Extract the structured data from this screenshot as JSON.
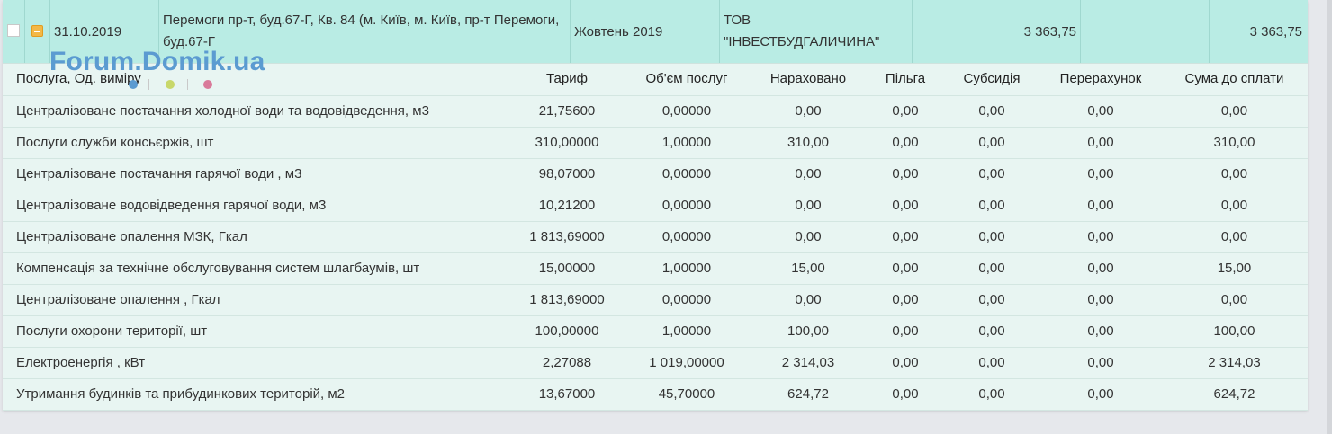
{
  "summary": {
    "date": "31.10.2019",
    "address": "Перемоги пр-т, буд.67-Г, Кв. 84 (м. Київ, м. Київ, пр-т Перемоги, буд.67-Г",
    "period": "Жовтень 2019",
    "company": "ТОВ \"ІНВЕСТБУДГАЛИЧИНА\"",
    "amount1": "3 363,75",
    "amount2": "",
    "amount3": "3 363,75"
  },
  "watermark": "Forum.Domik.ua",
  "legend_dots": [
    "#5b9bd1",
    "#c8d86a",
    "#d97a9a"
  ],
  "headers": {
    "service": "Послуга, Од. виміру",
    "tariff": "Тариф",
    "volume": "Об'єм послуг",
    "accrued": "Нараховано",
    "benefit": "Пільга",
    "subsidy": "Субсидія",
    "recalc": "Перерахунок",
    "total": "Сума до сплати"
  },
  "rows": [
    {
      "service": "Централізоване постачання холодної води та водовідведення, м3",
      "tariff": "21,75600",
      "volume": "0,00000",
      "accrued": "0,00",
      "benefit": "0,00",
      "subsidy": "0,00",
      "recalc": "0,00",
      "total": "0,00"
    },
    {
      "service": "Послуги служби консьєржів, шт",
      "tariff": "310,00000",
      "volume": "1,00000",
      "accrued": "310,00",
      "benefit": "0,00",
      "subsidy": "0,00",
      "recalc": "0,00",
      "total": "310,00"
    },
    {
      "service": "Централізоване постачання гарячої води , м3",
      "tariff": "98,07000",
      "volume": "0,00000",
      "accrued": "0,00",
      "benefit": "0,00",
      "subsidy": "0,00",
      "recalc": "0,00",
      "total": "0,00"
    },
    {
      "service": "Централізоване водовідведення гарячої води, м3",
      "tariff": "10,21200",
      "volume": "0,00000",
      "accrued": "0,00",
      "benefit": "0,00",
      "subsidy": "0,00",
      "recalc": "0,00",
      "total": "0,00"
    },
    {
      "service": "Централізоване опалення МЗК, Гкал",
      "tariff": "1 813,69000",
      "volume": "0,00000",
      "accrued": "0,00",
      "benefit": "0,00",
      "subsidy": "0,00",
      "recalc": "0,00",
      "total": "0,00"
    },
    {
      "service": "Компенсація за технічне обслуговування систем шлагбаумів, шт",
      "tariff": "15,00000",
      "volume": "1,00000",
      "accrued": "15,00",
      "benefit": "0,00",
      "subsidy": "0,00",
      "recalc": "0,00",
      "total": "15,00"
    },
    {
      "service": "Централізоване опалення , Гкал",
      "tariff": "1 813,69000",
      "volume": "0,00000",
      "accrued": "0,00",
      "benefit": "0,00",
      "subsidy": "0,00",
      "recalc": "0,00",
      "total": "0,00"
    },
    {
      "service": "Послуги охорони території, шт",
      "tariff": "100,00000",
      "volume": "1,00000",
      "accrued": "100,00",
      "benefit": "0,00",
      "subsidy": "0,00",
      "recalc": "0,00",
      "total": "100,00"
    },
    {
      "service": "Електроенергія , кВт",
      "tariff": "2,27088",
      "volume": "1 019,00000",
      "accrued": "2 314,03",
      "benefit": "0,00",
      "subsidy": "0,00",
      "recalc": "0,00",
      "total": "2 314,03"
    },
    {
      "service": "Утримання будинків та прибудинкових територій, м2",
      "tariff": "13,67000",
      "volume": "45,70000",
      "accrued": "624,72",
      "benefit": "0,00",
      "subsidy": "0,00",
      "recalc": "0,00",
      "total": "624,72"
    }
  ]
}
